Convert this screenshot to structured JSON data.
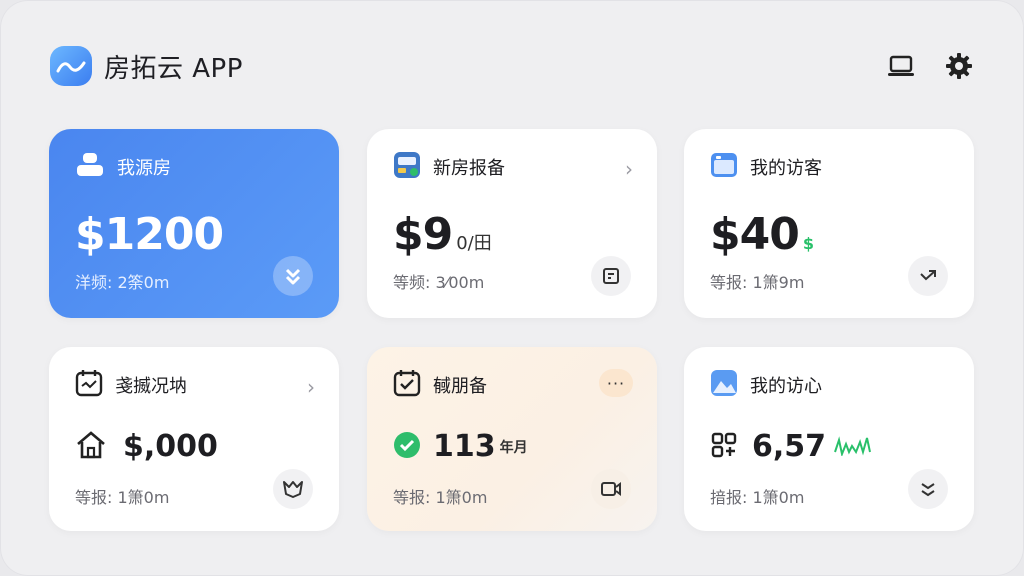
{
  "app": {
    "title": "房拓云 APP"
  },
  "cards": [
    {
      "title": "我源房",
      "value": "$1200",
      "unit": "",
      "sub": "洋频: 2筡0m"
    },
    {
      "title": "新房报备",
      "value": "$9",
      "unit": "0/田",
      "sub": "等频: 3⁄00m"
    },
    {
      "title": "我的访客",
      "value": "$40",
      "unit": "$",
      "sub": "等报: 1箫9m"
    },
    {
      "title": "戔揻况㘨",
      "value": "$,000",
      "unit": "",
      "sub": "等报: 1箫0m"
    },
    {
      "title": "戫朋备",
      "value": "113",
      "unit": "年月",
      "sub": "等报: 1箫0m",
      "more": "···"
    },
    {
      "title": "我的访心",
      "value": "6,57",
      "unit": "",
      "sub": "揞报: 1箫0m"
    }
  ],
  "colors": {
    "accent": "#4a86ef",
    "green": "#29c06a",
    "background": "#efeff1"
  }
}
